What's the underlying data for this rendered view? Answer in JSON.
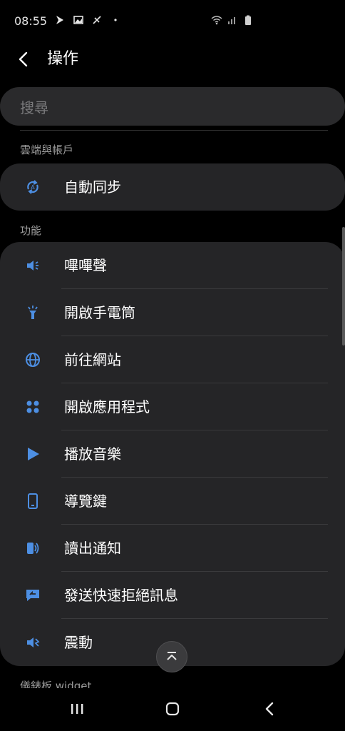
{
  "status_bar": {
    "time": "08:55",
    "left_icons": [
      "navigation-icon",
      "image-icon",
      "satellite-icon",
      "dot-icon"
    ],
    "right_icons": [
      "wifi-icon",
      "signal-icon",
      "battery-icon"
    ]
  },
  "header": {
    "title": "操作",
    "back_icon": "chevron-left-icon"
  },
  "search": {
    "placeholder": "搜尋"
  },
  "sections": {
    "cloud": {
      "title": "雲端與帳戶",
      "items": [
        {
          "label": "自動同步",
          "icon": "sync-icon"
        }
      ]
    },
    "features": {
      "title": "功能",
      "items": [
        {
          "label": "嗶嗶聲",
          "icon": "speaker-icon"
        },
        {
          "label": "開啟手電筒",
          "icon": "flashlight-icon"
        },
        {
          "label": "前往網站",
          "icon": "globe-icon"
        },
        {
          "label": "開啟應用程式",
          "icon": "apps-grid-icon"
        },
        {
          "label": "播放音樂",
          "icon": "play-icon"
        },
        {
          "label": "導覽鍵",
          "icon": "phone-icon"
        },
        {
          "label": "讀出通知",
          "icon": "read-aloud-icon"
        },
        {
          "label": "發送快速拒絕訊息",
          "icon": "reply-message-icon"
        },
        {
          "label": "震動",
          "icon": "vibrate-icon"
        }
      ]
    },
    "dashboard": {
      "title": "儀錶板 widget"
    }
  },
  "colors": {
    "background": "#000000",
    "card": "#252527",
    "accent": "#4d8fe3",
    "section_text": "#9a9a9a"
  },
  "nav": {
    "icons": [
      "recent-apps-icon",
      "home-icon",
      "back-icon"
    ]
  }
}
